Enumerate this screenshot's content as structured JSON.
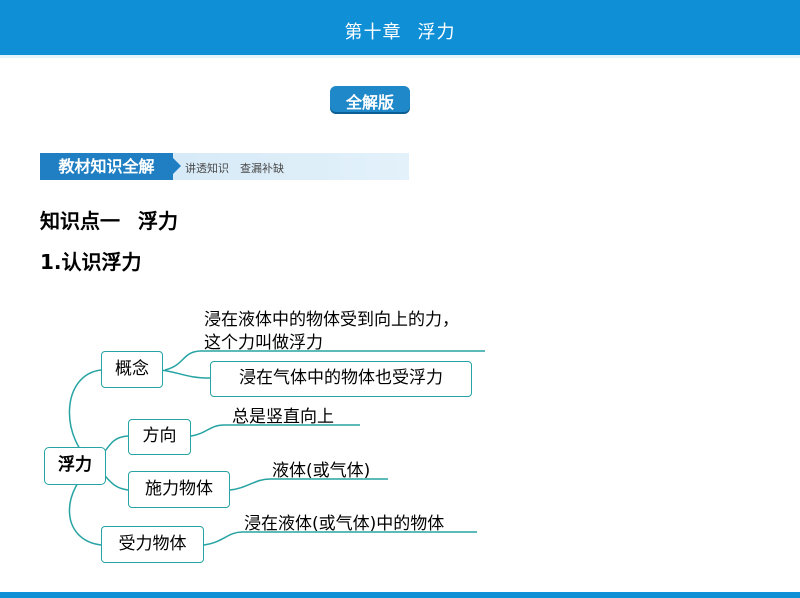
{
  "header": {
    "chapter": "第十章",
    "topic": "浮力"
  },
  "badge": "全解版",
  "ribbon": {
    "tag": "教材知识全解",
    "subtitle": "讲透知识　查漏补缺"
  },
  "heading1": {
    "num": "知识点一",
    "title": "浮力"
  },
  "heading2": "1.认识浮力",
  "mindmap": {
    "root": "浮力",
    "branches": [
      {
        "label": "概念",
        "notes": [
          "浸在液体中的物体受到向上的力，",
          "这个力叫做浮力"
        ],
        "sub": "浸在气体中的物体也受浮力"
      },
      {
        "label": "方向",
        "notes": [
          "总是竖直向上"
        ]
      },
      {
        "label": "施力物体",
        "notes": [
          "液体(或气体)"
        ]
      },
      {
        "label": "受力物体",
        "notes": [
          "浸在液体(或气体)中的物体"
        ]
      }
    ]
  }
}
